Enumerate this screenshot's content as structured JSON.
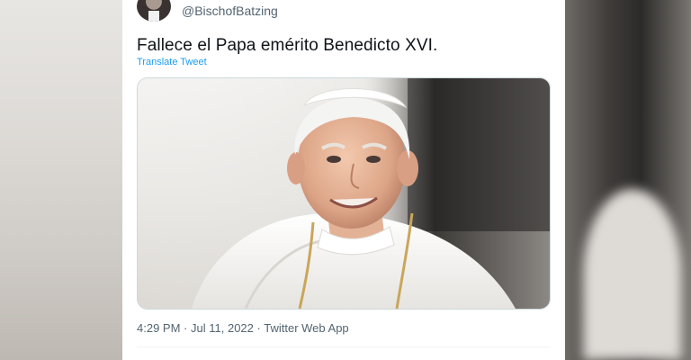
{
  "tweet": {
    "author_handle": "@BischofBatzing",
    "author_name_fragment": "",
    "text": "Fallece el Papa emérito Benedicto XVI.",
    "translate_label": "Translate Tweet",
    "time": "4:29 PM",
    "date": "Jul 11, 2022",
    "source": "Twitter Web App",
    "separator": "·"
  },
  "colors": {
    "link": "#1d9bf0",
    "text_primary": "#0f1419",
    "text_secondary": "#536471"
  }
}
